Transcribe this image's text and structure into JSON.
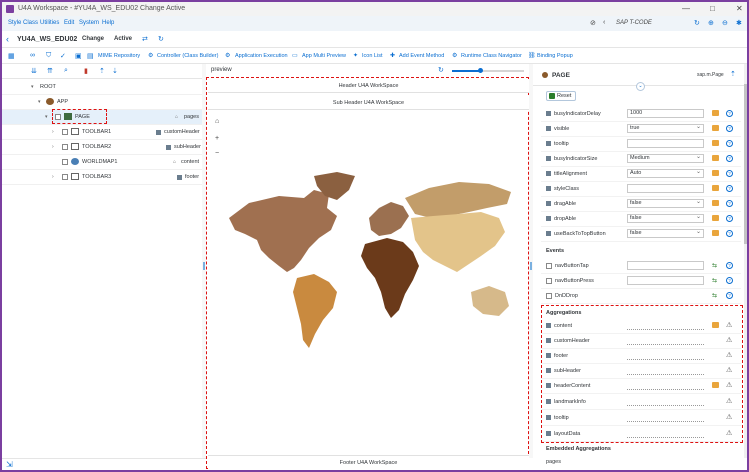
{
  "window": {
    "title": "U4A Workspace - #YU4A_WS_EDU02 Change Active",
    "controls": [
      "—",
      "□",
      "✕"
    ]
  },
  "menu": {
    "items": [
      "Style Class",
      "Utilities",
      "Edit",
      "System",
      "Help"
    ],
    "tcode": "SAP T-CODE"
  },
  "header": {
    "back": "‹",
    "app_name": "YU4A_WS_EDU02",
    "mode": "Change",
    "status": "Active"
  },
  "toolbar": {
    "items": [
      "MIME Repository",
      "Controller (Class Builder)",
      "Application Execution",
      "App Multi Preview",
      "Icon List",
      "Add Event Method",
      "Runtime Class Navigator",
      "Binding Popup"
    ]
  },
  "tree": {
    "rows": [
      {
        "label": "ROOT",
        "type": ""
      },
      {
        "label": "APP",
        "type": ""
      },
      {
        "label": "PAGE",
        "type": "pages"
      },
      {
        "label": "TOOLBAR1",
        "type": "customHeader"
      },
      {
        "label": "TOOLBAR2",
        "type": "subHeader"
      },
      {
        "label": "WORLDMAP1",
        "type": "content"
      },
      {
        "label": "TOOLBAR3",
        "type": "footer"
      }
    ]
  },
  "preview": {
    "label": "preview",
    "header_text": "Header U4A WorkSpace",
    "subheader_text": "Sub Header U4A WorkSpace",
    "footer_text": "Footer U4A WorkSpace",
    "zoom_level": 0.4,
    "map_controls": [
      "⌂",
      "+",
      "−"
    ]
  },
  "properties": {
    "title": "PAGE",
    "class_name": "sap.m.Page",
    "reset_label": "Reset",
    "rows": [
      {
        "name": "busyIndicatorDelay",
        "value": "1000",
        "select": false
      },
      {
        "name": "visible",
        "value": "true",
        "select": true
      },
      {
        "name": "tooltip",
        "value": "",
        "select": false
      },
      {
        "name": "busyIndicatorSize",
        "value": "Medium",
        "select": true
      },
      {
        "name": "titleAlignment",
        "value": "Auto",
        "select": true
      },
      {
        "name": "styleClass",
        "value": "",
        "select": false
      },
      {
        "name": "dragAble",
        "value": "false",
        "select": true
      },
      {
        "name": "dropAble",
        "value": "false",
        "select": true
      },
      {
        "name": "useBackToTopButton",
        "value": "false",
        "select": true
      }
    ],
    "events_title": "Events",
    "events": [
      "navButtonTap",
      "navButtonPress",
      "DnDDrop"
    ],
    "aggregations_title": "Aggregations",
    "aggregations": [
      "content",
      "customHeader",
      "footer",
      "subHeader",
      "headerContent",
      "landmarkInfo",
      "tooltip",
      "layoutData"
    ],
    "embedded_title": "Embedded Aggregations",
    "embedded_value": "pages"
  },
  "colors": {
    "accent": "#0a6ed1",
    "highlight": "#d11111",
    "frame": "#7b3fa0",
    "africa": "#6b3a1a",
    "south_america": "#c98a3f",
    "north_america": "#a07050",
    "europe": "#9b7050",
    "asia": "#e3c48a",
    "australia": "#d6b98a",
    "greenland": "#8b6040",
    "russia": "#c29d6a"
  }
}
